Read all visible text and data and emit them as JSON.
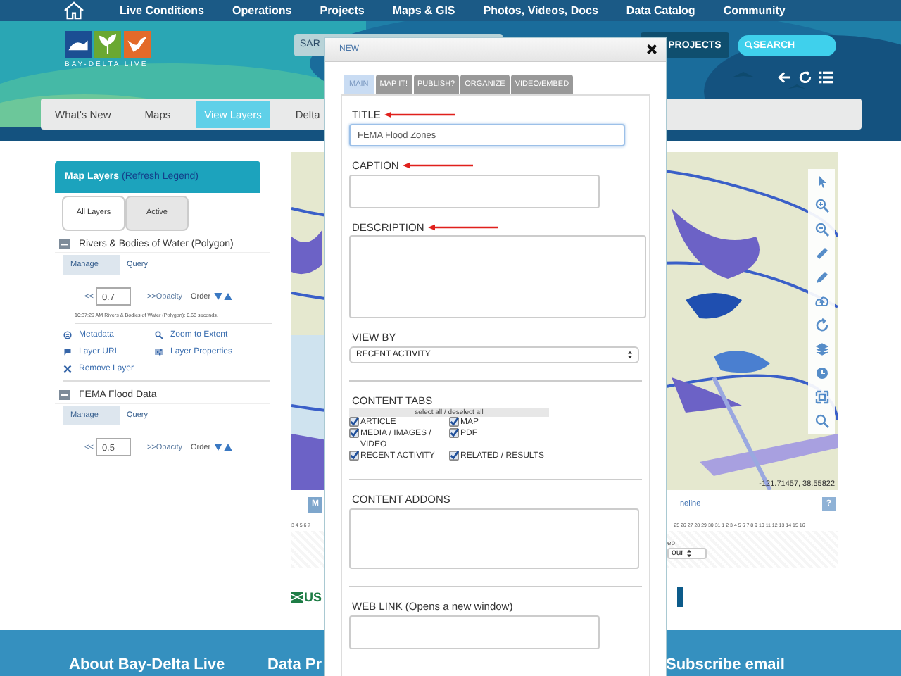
{
  "top_nav": {
    "items": [
      "Live Conditions",
      "Operations",
      "Projects",
      "Maps & GIS",
      "Photos, Videos, Docs",
      "Data Catalog",
      "Community"
    ]
  },
  "logo": {
    "text": "BAY-DELTA LIVE"
  },
  "header": {
    "search_value": "SAR",
    "projects_button": "PROJECTS",
    "search_placeholder": "SEARCH"
  },
  "section_tabs": [
    {
      "label": "What's New",
      "selected": false
    },
    {
      "label": "Maps",
      "selected": false
    },
    {
      "label": "View Layers",
      "selected": true
    },
    {
      "label": "Delta",
      "selected": false
    }
  ],
  "layers_panel": {
    "title": "Map Layers",
    "refresh_link": "(Refresh Legend)",
    "tabs": [
      {
        "label": "All Layers",
        "selected": true
      },
      {
        "label": "Active",
        "selected": false
      }
    ],
    "layers": [
      {
        "name": "Rivers & Bodies of Water (Polygon)",
        "subtabs": [
          {
            "label": "Manage",
            "selected": true
          },
          {
            "label": "Query",
            "selected": false
          }
        ],
        "opacity_prefix": "<<",
        "opacity": "0.7",
        "opacity_label": ">>Opacity",
        "order_label": "Order",
        "status": "10:37:29 AM Rivers & Bodies of Water (Polygon): 0.68 seconds.",
        "actions": [
          {
            "kind": "metadata",
            "label": "Metadata"
          },
          {
            "kind": "zoom",
            "label": "Zoom to Extent"
          },
          {
            "kind": "url",
            "label": "Layer URL"
          },
          {
            "kind": "properties",
            "label": "Layer Properties"
          },
          {
            "kind": "remove",
            "label": "Remove Layer"
          }
        ]
      },
      {
        "name": "FEMA Flood Data",
        "subtabs": [
          {
            "label": "Manage",
            "selected": true
          },
          {
            "label": "Query",
            "selected": false
          }
        ],
        "opacity_prefix": "<<",
        "opacity": "0.5",
        "opacity_label": ">>Opacity",
        "order_label": "Order"
      }
    ]
  },
  "map": {
    "coordinates": "-121.71457, 38.55822",
    "m_button": "M",
    "timeline_link": "neline",
    "help_button": "?",
    "days_left": "3 4 5 6 7",
    "days_right": "25 26 27 28 29 30 31 1 2 3 4 5 6 7 8 9 10 11 12 13 14 15 16",
    "step_label": "ep",
    "step_select": "our",
    "partner_logo": "US"
  },
  "footer": {
    "items": [
      "About Bay-Delta Live",
      "Data Pr",
      "Subscribe email"
    ]
  },
  "modal": {
    "title": "NEW",
    "tabs": [
      {
        "label": "MAIN",
        "selected": true
      },
      {
        "label": "MAP IT!",
        "selected": false
      },
      {
        "label": "PUBLISH?",
        "selected": false
      },
      {
        "label": "ORGANIZE",
        "selected": false
      },
      {
        "label": "VIDEO/EMBED",
        "selected": false
      }
    ],
    "fields": [
      {
        "kind": "input",
        "label": "TITLE",
        "value": "FEMA Flood Zones",
        "arrow": true
      },
      {
        "kind": "short_area",
        "label": "CAPTION",
        "arrow": true
      },
      {
        "kind": "tall_area",
        "label": "DESCRIPTION",
        "arrow": true
      },
      {
        "kind": "select",
        "label": "VIEW BY",
        "value": "RECENT ACTIVITY",
        "arrow": false
      },
      {
        "kind": "checks",
        "label": "CONTENT TABS",
        "select_all": "select all / deselect all",
        "arrow": false,
        "options": [
          {
            "label": "ARTICLE",
            "checked": true
          },
          {
            "label": "MAP",
            "checked": true
          },
          {
            "label": "MEDIA / IMAGES / VIDEO",
            "checked": true
          },
          {
            "label": "PDF",
            "checked": true
          },
          {
            "label": "RECENT ACTIVITY",
            "checked": true
          },
          {
            "label": "RELATED / RESULTS",
            "checked": true
          }
        ]
      },
      {
        "kind": "wide_area",
        "label": "CONTENT ADDONS",
        "arrow": false
      },
      {
        "kind": "link_area",
        "label": "WEB LINK (Opens a new window)",
        "arrow": false
      }
    ]
  }
}
